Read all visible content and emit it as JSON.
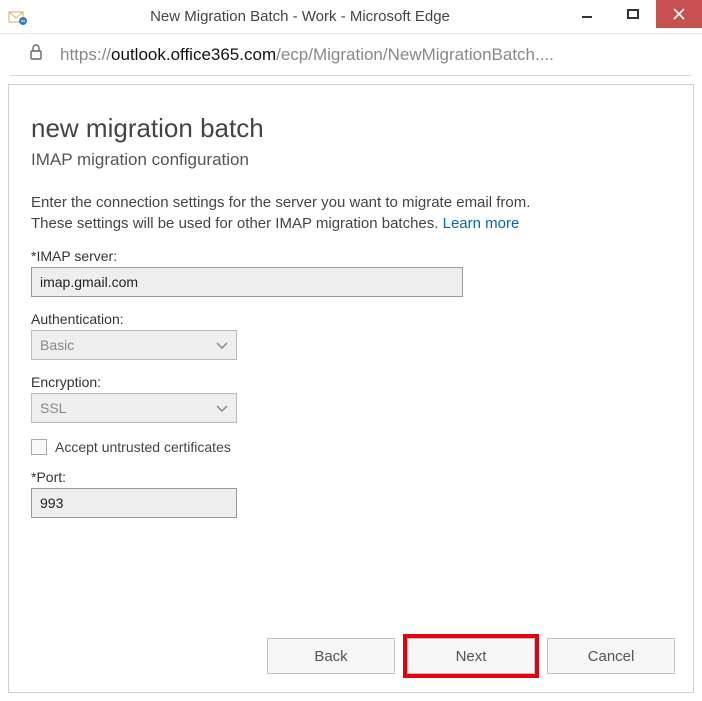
{
  "window": {
    "title": "New Migration Batch - Work - Microsoft Edge"
  },
  "address": {
    "prefix": "https://",
    "host": "outlook.office365.com",
    "path": "/ecp/Migration/NewMigrationBatch...."
  },
  "page": {
    "heading": "new migration batch",
    "subheading": "IMAP migration configuration",
    "description": "Enter the connection settings for the server you want to migrate email from. These settings will be used for other IMAP migration batches.",
    "learn_more": "Learn more"
  },
  "form": {
    "imap_label": "*IMAP server:",
    "imap_value": "imap.gmail.com",
    "auth_label": "Authentication:",
    "auth_value": "Basic",
    "enc_label": "Encryption:",
    "enc_value": "SSL",
    "cert_label": "Accept untrusted certificates",
    "port_label": "*Port:",
    "port_value": "993"
  },
  "buttons": {
    "back": "Back",
    "next": "Next",
    "cancel": "Cancel"
  }
}
